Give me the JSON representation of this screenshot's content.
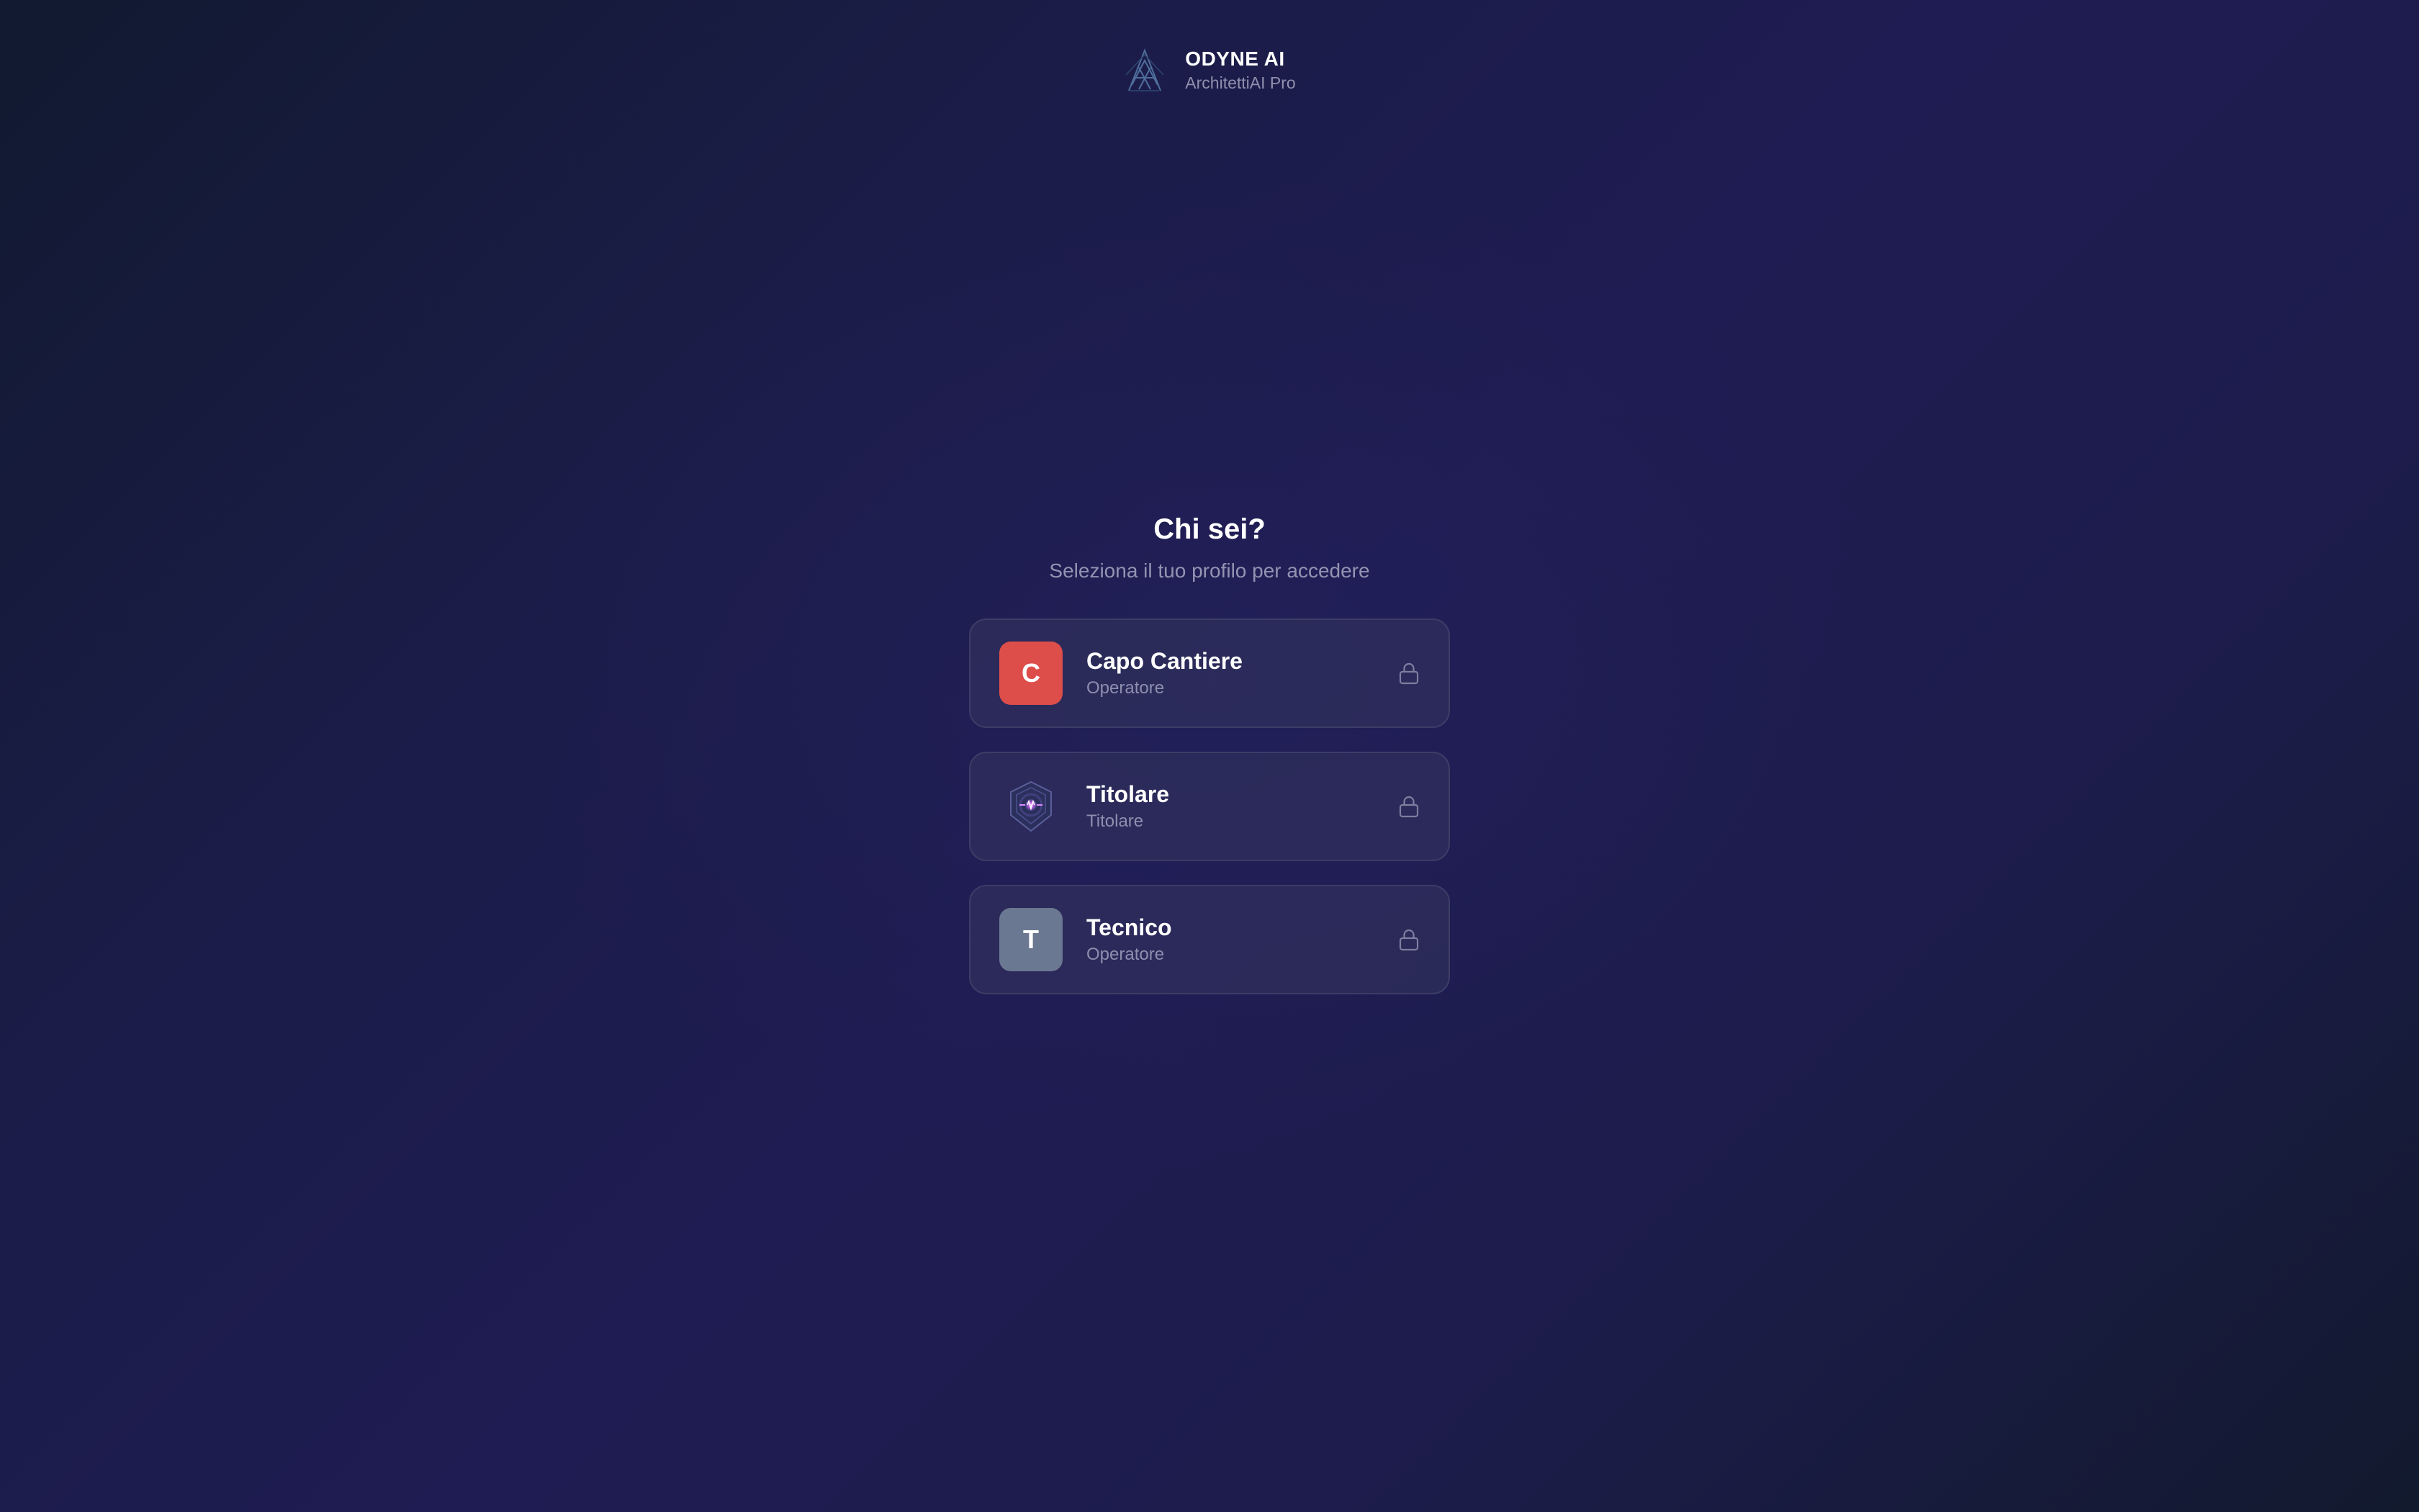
{
  "brand": {
    "name": "ODYNE AI",
    "subtitle": "ArchitettiAI Pro",
    "logo_icon": "odyne-logo-icon"
  },
  "main": {
    "title": "Chi sei?",
    "subtitle": "Seleziona il tuo profilo per accedere"
  },
  "profiles": [
    {
      "initial": "C",
      "name": "Capo Cantiere",
      "role": "Operatore",
      "avatar_color": "#dd4e4b",
      "icon": "lock-icon"
    },
    {
      "name": "Titolare",
      "role": "Titolare",
      "avatar_icon": "odyne-emblem-icon",
      "icon": "lock-icon"
    },
    {
      "initial": "T",
      "name": "Tecnico",
      "role": "Operatore",
      "avatar_color": "#6b7891",
      "icon": "lock-icon"
    }
  ],
  "colors": {
    "background": "#1d1c4c",
    "card_border": "#3b3d66",
    "muted_text": "#9294b2"
  }
}
